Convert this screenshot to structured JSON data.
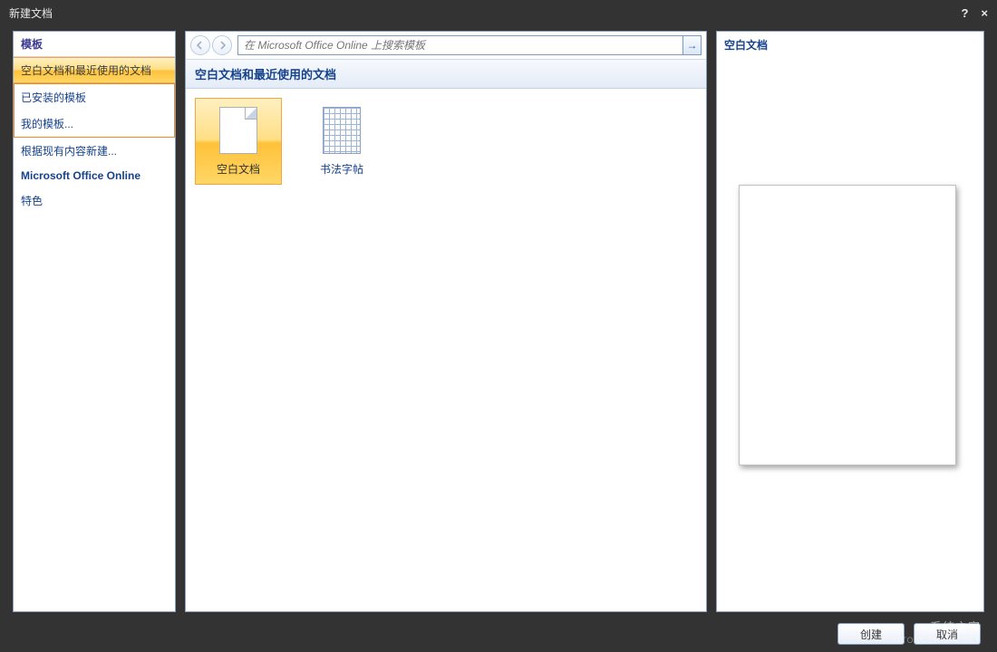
{
  "window": {
    "title": "新建文档",
    "help": "?",
    "close": "×"
  },
  "sidebar": {
    "header": "模板",
    "items": [
      {
        "label": "空白文档和最近使用的文档",
        "selected": true
      },
      {
        "label": "已安装的模板"
      },
      {
        "label": "我的模板..."
      },
      {
        "label": "根据现有内容新建..."
      }
    ],
    "section_heading": "Microsoft Office Online",
    "online_items": [
      {
        "label": "特色"
      }
    ]
  },
  "search": {
    "placeholder": "在 Microsoft Office Online 上搜索模板",
    "go": "→"
  },
  "content": {
    "section_title": "空白文档和最近使用的文档",
    "templates": [
      {
        "label": "空白文档",
        "icon": "blank",
        "selected": true
      },
      {
        "label": "书法字帖",
        "icon": "grid",
        "selected": false
      }
    ]
  },
  "preview": {
    "title": "空白文档"
  },
  "footer": {
    "create": "创建",
    "cancel": "取消"
  },
  "watermark": {
    "main": "系统之家",
    "sub": "XITONGZHIJIA.NET"
  }
}
